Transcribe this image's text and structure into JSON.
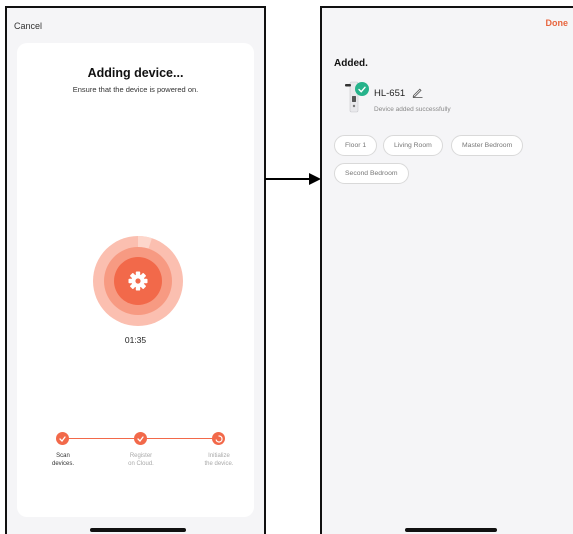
{
  "left_screen": {
    "cancel_label": "Cancel",
    "title": "Adding device...",
    "subtitle": "Ensure that the device is powered on.",
    "progress_fraction": 0.05,
    "timer": "01:35",
    "steps": [
      {
        "line1": "Scan",
        "line2": "devices.",
        "state": "done"
      },
      {
        "line1": "Register",
        "line2": "on Cloud.",
        "state": "done"
      },
      {
        "line1": "Initialize",
        "line2": "the device.",
        "state": "in-progress"
      }
    ],
    "accent_color": "#f2694a"
  },
  "right_screen": {
    "done_label": "Done",
    "added_title": "Added.",
    "device_name": "HL-651",
    "device_status": "Device added successfully",
    "rooms": [
      "Floor 1",
      "Living Room",
      "Master Bedroom",
      "Second Bedroom"
    ],
    "success_color": "#26b38b",
    "done_color": "#e8663f"
  }
}
